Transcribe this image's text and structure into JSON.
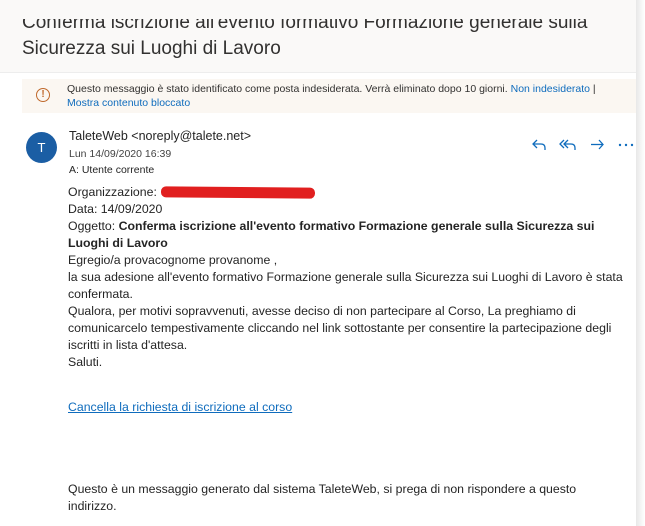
{
  "subject": {
    "title": "Conferma iscrizione all'evento formativo Formazione generale sulla Sicurezza sui Luoghi di Lavoro"
  },
  "junk_warning": {
    "text": "Questo messaggio è stato identificato come posta indesiderata. Verrà eliminato dopo 10 giorni.",
    "not_junk_link": "Non indesiderato",
    "separator": "|",
    "show_blocked_link": "Mostra contenuto bloccato",
    "icon": "warning-circle-icon"
  },
  "sender": {
    "avatar_initial": "T",
    "avatar_color": "#1b5ea4",
    "name_line": "TaleteWeb <noreply@talete.net>",
    "date": "Lun 14/09/2020 16:39",
    "to": "A:  Utente corrente"
  },
  "actions": [
    {
      "name": "reply",
      "icon": "reply-icon"
    },
    {
      "name": "reply-all",
      "icon": "reply-all-icon"
    },
    {
      "name": "forward",
      "icon": "forward-icon"
    },
    {
      "name": "more",
      "icon": "more-icon"
    }
  ],
  "body": {
    "org_label": "Organizzazione:",
    "date_line": "Data: 14/09/2020",
    "subject_label": "Oggetto:",
    "subject_text": "Conferma iscrizione all'evento formativo Formazione generale sulla Sicurezza sui Luoghi di Lavoro",
    "greeting": "Egregio/a provacognome provanome ,",
    "paragraph1": "la sua adesione all'evento formativo Formazione generale sulla Sicurezza sui Luoghi di Lavoro è stata confermata.",
    "paragraph2": "Qualora, per motivi sopravvenuti, avesse deciso di non partecipare al Corso, La preghiamo di comunicarcelo tempestivamente cliccando nel link sottostante per consentire la partecipazione degli iscritti in lista d'attesa.",
    "closing": "Saluti.",
    "cancel_link": "Cancella la richiesta di iscrizione al corso",
    "footer": "Questo è un messaggio generato dal sistema TaleteWeb, si prega di non rispondere a questo indirizzo."
  },
  "colors": {
    "accent": "#0f6cbd",
    "redaction": "#e11f1f",
    "warning": "#c0692c"
  }
}
